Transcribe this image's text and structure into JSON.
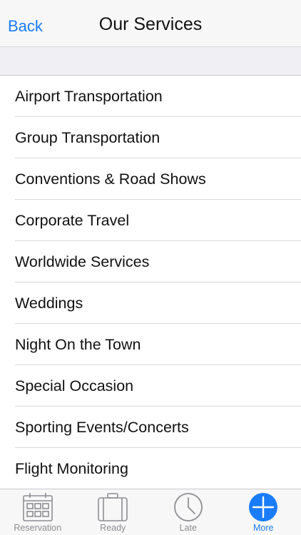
{
  "navbar": {
    "back_label": "Back",
    "title": "Our Services"
  },
  "services": [
    "Airport Transportation",
    "Group Transportation",
    "Conventions & Road Shows",
    "Corporate Travel",
    "Worldwide Services",
    "Weddings",
    "Night On the Town",
    "Special Occasion",
    "Sporting Events/Concerts",
    "Flight Monitoring"
  ],
  "tabbar": {
    "tabs": [
      {
        "label": "Reservation",
        "icon": "calendar-icon",
        "active": false
      },
      {
        "label": "Ready",
        "icon": "luggage-icon",
        "active": false
      },
      {
        "label": "Late",
        "icon": "clock-icon",
        "active": false
      },
      {
        "label": "More",
        "icon": "plus-circle-icon",
        "active": true
      }
    ]
  },
  "colors": {
    "accent": "#1a7cf7",
    "inactive": "#8e8e93"
  }
}
